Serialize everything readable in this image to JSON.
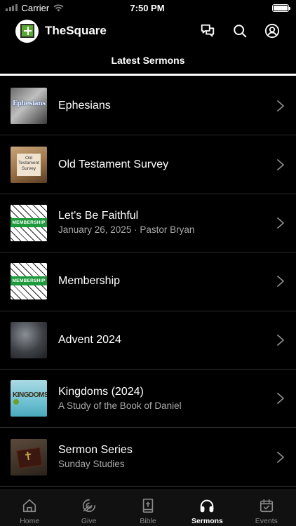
{
  "status_bar": {
    "carrier": "Carrier",
    "time": "7:50 PM"
  },
  "app": {
    "title": "TheSquare"
  },
  "header_icons": [
    "chat-icon",
    "search-icon",
    "account-icon"
  ],
  "section": {
    "title": "Latest Sermons"
  },
  "sermons": [
    {
      "title": "Ephesians",
      "subtitle": "",
      "thumb": "ephesians",
      "thumb_text": "Ephesians"
    },
    {
      "title": "Old Testament Survey",
      "subtitle": "",
      "thumb": "survey",
      "thumb_text": "Old Testament Survey"
    },
    {
      "title": "Let's Be Faithful",
      "subtitle": "January 26, 2025 · Pastor Bryan",
      "thumb": "membership",
      "thumb_text": "MEMBERSHIP"
    },
    {
      "title": "Membership",
      "subtitle": "",
      "thumb": "membership",
      "thumb_text": "MEMBERSHIP"
    },
    {
      "title": "Advent 2024",
      "subtitle": "",
      "thumb": "advent",
      "thumb_text": ""
    },
    {
      "title": "Kingdoms (2024)",
      "subtitle": "A Study of the Book of Daniel",
      "thumb": "kingdoms",
      "thumb_text": "KINGDOMS"
    },
    {
      "title": "Sermon Series",
      "subtitle": "Sunday Studies",
      "thumb": "bible",
      "thumb_text": ""
    }
  ],
  "tabs": [
    {
      "label": "Home",
      "icon": "home-icon",
      "active": false
    },
    {
      "label": "Give",
      "icon": "give-icon",
      "active": false
    },
    {
      "label": "Bible",
      "icon": "bible-icon",
      "active": false
    },
    {
      "label": "Sermons",
      "icon": "headphones-icon",
      "active": true
    },
    {
      "label": "Events",
      "icon": "calendar-icon",
      "active": false
    }
  ],
  "colors": {
    "background": "#000000",
    "accent": "#ffffff",
    "secondary_text": "#a9a9a9",
    "logo_green": "#5aa832"
  }
}
